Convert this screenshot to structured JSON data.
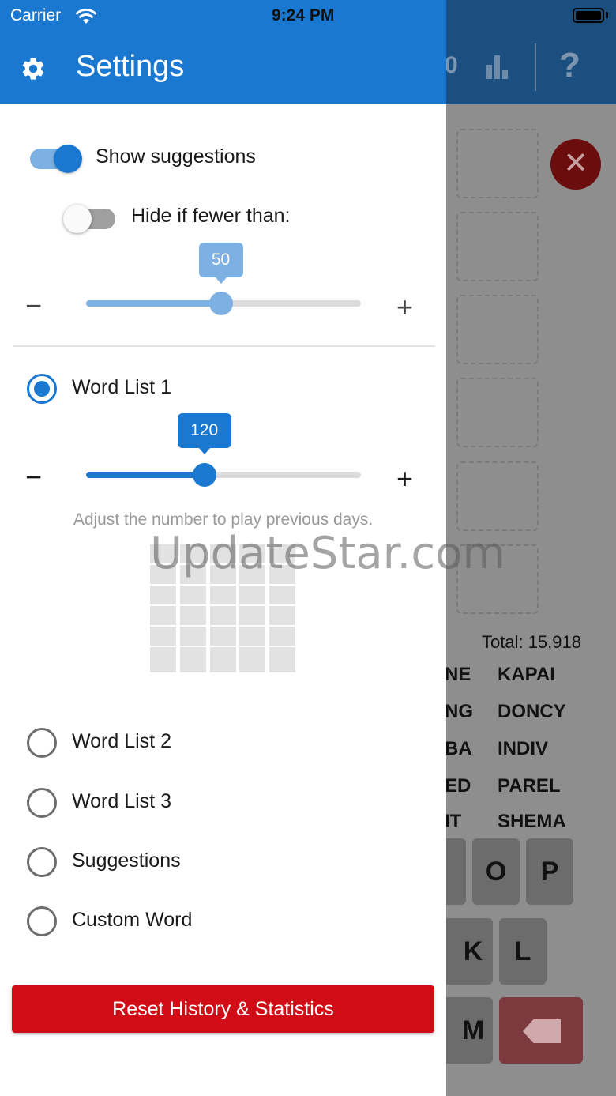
{
  "status_bar": {
    "carrier": "Carrier",
    "time": "9:24 PM"
  },
  "header": {
    "title": "Settings"
  },
  "settings": {
    "show_suggestions": {
      "label": "Show suggestions",
      "enabled": true
    },
    "hide_if_fewer": {
      "label": "Hide if fewer than:",
      "enabled": false
    },
    "suggestion_threshold": {
      "value": "50",
      "fraction": 0.49,
      "minus": "−",
      "plus": "+"
    },
    "word_lists": [
      {
        "label": "Word List 1",
        "selected": true
      },
      {
        "label": "Word List 2",
        "selected": false
      },
      {
        "label": "Word List 3",
        "selected": false
      },
      {
        "label": "Suggestions",
        "selected": false
      },
      {
        "label": "Custom Word",
        "selected": false
      }
    ],
    "day_slider": {
      "value": "120",
      "fraction": 0.43,
      "minus": "−",
      "plus": "+"
    },
    "hint": "Adjust the number to play previous days.",
    "reset_button": "Reset History & Statistics"
  },
  "watermark": "UpdateStar.com",
  "background_game": {
    "header_partial_glyph": "0",
    "help_glyph": "?",
    "close_glyph": "✕",
    "total_label": "Total: 15,918",
    "words_left": [
      "NE",
      "NG",
      "BA",
      "ED",
      "IT"
    ],
    "words_right": [
      "KAPAI",
      "DONCY",
      "INDIV",
      "PAREL",
      "SHEMA"
    ],
    "keys": [
      "O",
      "P",
      "K",
      "L",
      "M"
    ]
  },
  "colors": {
    "primary": "#1b78d0",
    "primary_light": "#7db0e3",
    "danger": "#d00d17",
    "overlay": "#8e8e8e"
  }
}
